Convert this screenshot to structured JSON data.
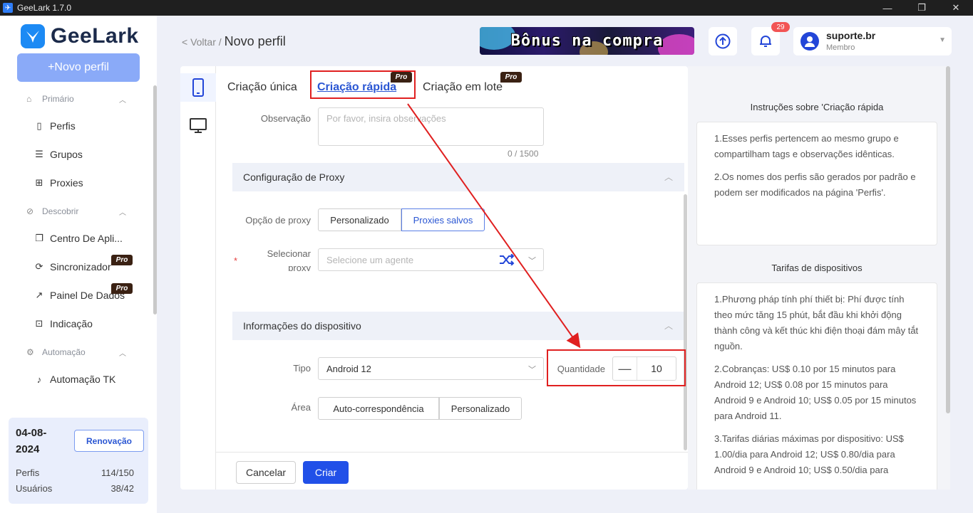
{
  "window": {
    "title": "GeeLark 1.7.0",
    "icon": "app-logo"
  },
  "sidebar": {
    "brand": "GeeLark",
    "new_profile": "+Novo perfil",
    "sections": [
      {
        "label": "Primário",
        "icon": "home-icon"
      },
      {
        "label": "Descobrir",
        "icon": "compass-icon"
      },
      {
        "label": "Automação",
        "icon": "automation-icon"
      }
    ],
    "items": [
      {
        "label": "Perfis",
        "icon": "profile-icon"
      },
      {
        "label": "Grupos",
        "icon": "list-icon"
      },
      {
        "label": "Proxies",
        "icon": "network-icon"
      },
      {
        "label": "Centro De Apli...",
        "icon": "apps-icon"
      },
      {
        "label": "Sincronizador",
        "icon": "sync-icon",
        "pro": "Pro"
      },
      {
        "label": "Painel De Dados",
        "icon": "chart-icon",
        "pro": "Pro"
      },
      {
        "label": "Indicação",
        "icon": "gift-icon"
      },
      {
        "label": "Automação TK",
        "icon": "tiktok-icon"
      }
    ],
    "plan": {
      "date": "04-08-2024",
      "renew": "Renovação",
      "profiles_label": "Perfis",
      "profiles_value": "114/150",
      "users_label": "Usuários",
      "users_value": "38/42"
    }
  },
  "header": {
    "back": "< Voltar /",
    "title": "Novo perfil",
    "banner": "Bônus na compra",
    "notifications_count": "29",
    "user_name": "suporte.br",
    "user_role": "Membro"
  },
  "form": {
    "tabs": [
      {
        "label": "Criação única"
      },
      {
        "label": "Criação rápida",
        "pro": "Pro"
      },
      {
        "label": "Criação em lote",
        "pro": "Pro"
      }
    ],
    "observation_label": "Observação",
    "observation_placeholder": "Por favor, insira observações",
    "observation_counter": "0 / 1500",
    "proxy_section": "Configuração de Proxy",
    "proxy_option_label": "Opção de proxy",
    "proxy_options": [
      "Personalizado",
      "Proxies salvos"
    ],
    "proxy_option_selected": "Proxies salvos",
    "select_proxy_label": "Selecionar proxy",
    "select_proxy_required": "*",
    "select_proxy_placeholder": "Selecione um agente",
    "device_section": "Informações do dispositivo",
    "type_label": "Tipo",
    "type_value": "Android 12",
    "quantity_label": "Quantidade",
    "quantity_minus": "—",
    "quantity_value": "10",
    "area_label": "Área",
    "area_options": [
      "Auto-correspondência",
      "Personalizado"
    ],
    "cancel": "Cancelar",
    "create": "Criar"
  },
  "instructions": {
    "title": "Instruções sobre 'Criação rápida",
    "items": [
      "1.Esses perfis pertencem ao mesmo grupo e compartilham tags e observações idênticas.",
      "2.Os nomes dos perfis são gerados por padrão e podem ser modificados na página 'Perfis'."
    ],
    "rates_title": "Tarifas de dispositivos",
    "rates": [
      "1.Phương pháp tính phí thiết bị: Phí được tính theo mức tăng 15 phút, bắt đầu khi khởi động thành công và kết thúc khi điện thoại đám mây tắt nguồn.",
      "2.Cobranças: US$ 0.10 por 15 minutos para Android 12; US$ 0.08 por 15 minutos para Android 9 e Android 10; US$ 0.05 por 15 minutos para Android 11.",
      "3.Tarifas diárias máximas por dispositivo: US$ 1.00/dia para Android 12; US$ 0.80/dia para Android 9 e Android 10; US$ 0.50/dia para"
    ]
  },
  "colors": {
    "accent": "#2150e8",
    "annotation": "#e02020",
    "sidebar_button": "#8aaaf8"
  }
}
